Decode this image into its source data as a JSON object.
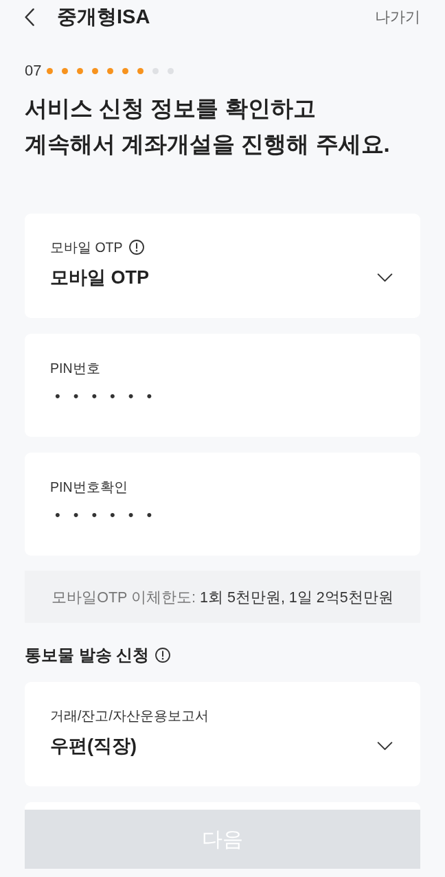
{
  "header": {
    "title": "중개형ISA",
    "exit": "나가기"
  },
  "progress": {
    "step": "07",
    "dots": [
      {
        "done": true
      },
      {
        "done": true
      },
      {
        "done": true
      },
      {
        "done": true
      },
      {
        "done": true
      },
      {
        "done": true
      },
      {
        "done": true
      },
      {
        "done": false
      },
      {
        "done": false
      }
    ]
  },
  "heading": {
    "lines": [
      "서비스 신청 정보를 확인하고",
      "계속해서 계좌개설을 진행해 주세요."
    ]
  },
  "fields": [
    {
      "kind": "select",
      "label": "모바일 OTP",
      "info": true,
      "value": "모바일 OTP"
    },
    {
      "kind": "password",
      "label": "PIN번호",
      "info": false,
      "value": "••••••"
    },
    {
      "kind": "password",
      "label": "PIN번호확인",
      "info": false,
      "value": "••••••"
    }
  ],
  "limit_notice": {
    "label": "모바일OTP 이체한도:",
    "value": "1회 5천만원, 1일 2억5천만원"
  },
  "mail_section": {
    "title": "통보물 발송 신청",
    "info": true,
    "fields": [
      {
        "kind": "select",
        "label": "거래/잔고/자산운용보고서",
        "info": false,
        "value": "우편(직장)"
      }
    ]
  },
  "next_button": {
    "label": "다음",
    "disabled": true
  }
}
